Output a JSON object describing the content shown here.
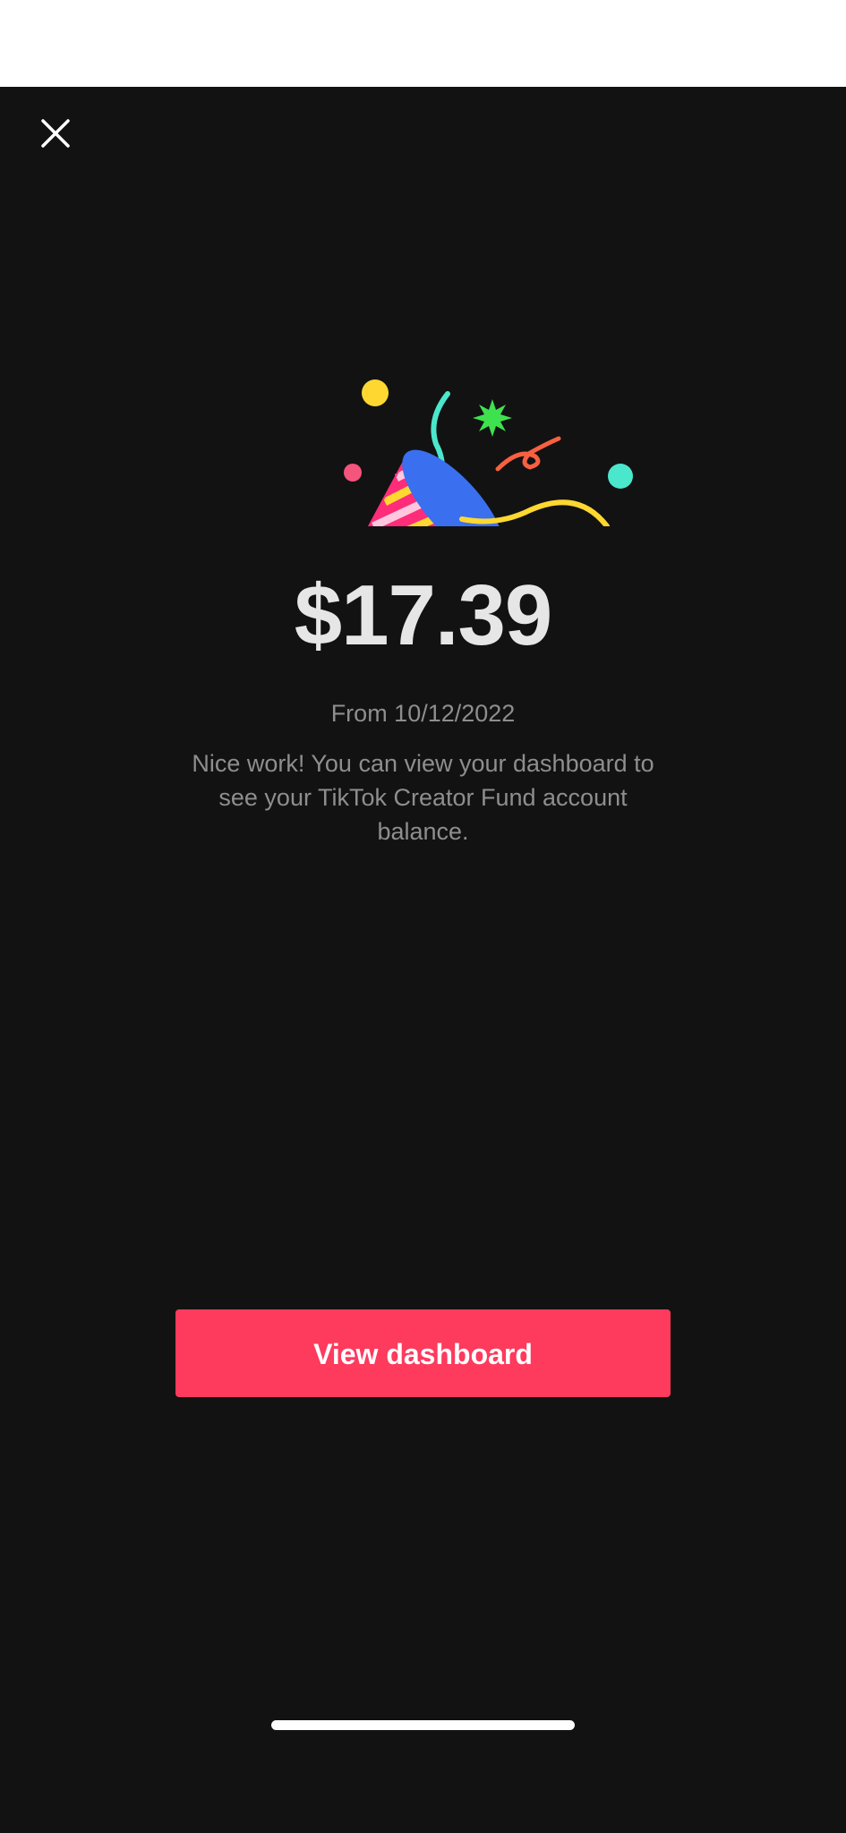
{
  "payout": {
    "amount": "$17.39",
    "from_date": "From 10/12/2022",
    "message": "Nice work! You can view your dashboard to see your TikTok Creator Fund account balance."
  },
  "actions": {
    "view_dashboard_label": "View dashboard"
  },
  "icons": {
    "close": "close-icon",
    "celebration": "party-popper-icon"
  },
  "colors": {
    "background": "#121212",
    "primary_button": "#fe3a5d",
    "amount_text": "#e6e6e6",
    "secondary_text": "#8e8e8e"
  }
}
